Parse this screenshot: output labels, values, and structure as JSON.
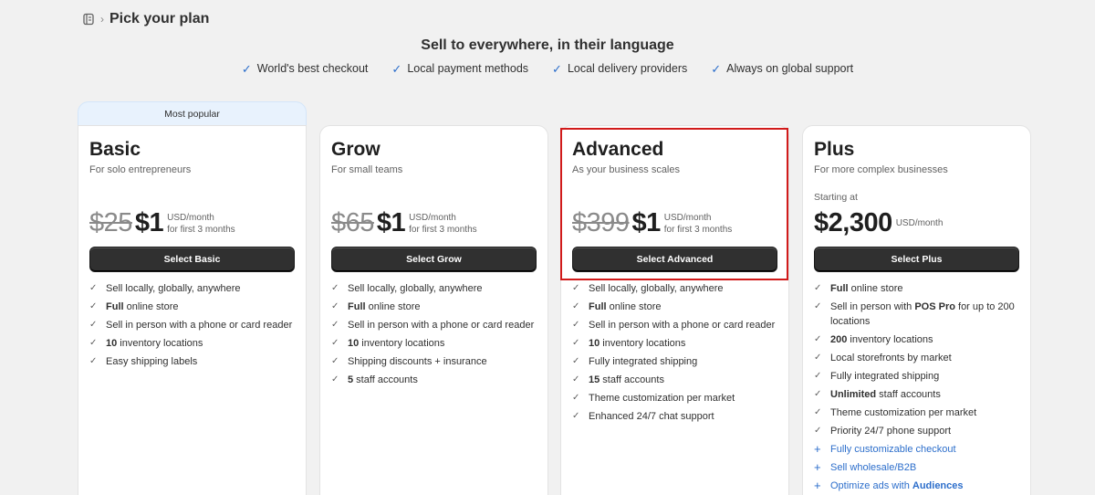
{
  "breadcrumb": {
    "icon": "store-icon",
    "separator": "›",
    "title": "Pick your plan"
  },
  "hero": {
    "title": "Sell to everywhere, in their language",
    "features": [
      "World's best checkout",
      "Local payment methods",
      "Local delivery providers",
      "Always on global support"
    ]
  },
  "badge": "Most popular",
  "plans": {
    "basic": {
      "name": "Basic",
      "sub": "For solo entrepreneurs",
      "old_price": "$25",
      "new_price": "$1",
      "note1": "USD/month",
      "note2": "for first 3 months",
      "button": "Select Basic",
      "features": [
        {
          "parts": [
            "Sell locally, globally, anywhere"
          ]
        },
        {
          "bold": "Full",
          "rest": " online store"
        },
        {
          "parts": [
            "Sell in person with a phone or card reader"
          ]
        },
        {
          "bold": "10",
          "rest": " inventory locations"
        },
        {
          "parts": [
            "Easy shipping labels"
          ]
        }
      ]
    },
    "grow": {
      "name": "Grow",
      "sub": "For small teams",
      "old_price": "$65",
      "new_price": "$1",
      "note1": "USD/month",
      "note2": "for first 3 months",
      "button": "Select Grow",
      "features": [
        {
          "parts": [
            "Sell locally, globally, anywhere"
          ]
        },
        {
          "bold": "Full",
          "rest": " online store"
        },
        {
          "parts": [
            "Sell in person with a phone or card reader"
          ]
        },
        {
          "bold": "10",
          "rest": " inventory locations"
        },
        {
          "parts": [
            "Shipping discounts + insurance"
          ]
        },
        {
          "bold": "5",
          "rest": " staff accounts"
        }
      ]
    },
    "advanced": {
      "name": "Advanced",
      "sub": "As your business scales",
      "old_price": "$399",
      "new_price": "$1",
      "note1": "USD/month",
      "note2": "for first 3 months",
      "button": "Select Advanced",
      "features": [
        {
          "parts": [
            "Sell locally, globally, anywhere"
          ]
        },
        {
          "bold": "Full",
          "rest": " online store"
        },
        {
          "parts": [
            "Sell in person with a phone or card reader"
          ]
        },
        {
          "bold": "10",
          "rest": " inventory locations"
        },
        {
          "parts": [
            "Fully integrated shipping"
          ]
        },
        {
          "bold": "15",
          "rest": " staff accounts"
        },
        {
          "parts": [
            "Theme customization per market"
          ]
        },
        {
          "parts": [
            "Enhanced 24/7 chat support"
          ]
        }
      ]
    },
    "plus": {
      "name": "Plus",
      "sub": "For more complex businesses",
      "starting": "Starting at",
      "new_price": "$2,300",
      "note1": "USD/month",
      "button": "Select Plus",
      "features": [
        {
          "bold": "Full",
          "rest": " online store"
        },
        {
          "pre": "Sell in person with ",
          "bold": "POS Pro",
          "rest": " for up to 200 locations"
        },
        {
          "bold": "200",
          "rest": " inventory locations"
        },
        {
          "parts": [
            "Local storefronts by market"
          ]
        },
        {
          "parts": [
            "Fully integrated shipping"
          ]
        },
        {
          "bold": "Unlimited",
          "rest": " staff accounts"
        },
        {
          "parts": [
            "Theme customization per market"
          ]
        },
        {
          "parts": [
            "Priority 24/7 phone support"
          ]
        },
        {
          "plus": true,
          "parts": [
            "Fully customizable checkout"
          ]
        },
        {
          "plus": true,
          "parts": [
            "Sell wholesale/B2B"
          ]
        },
        {
          "plus": true,
          "pre": "Optimize ads with ",
          "bold": "Audiences",
          "rest": ""
        }
      ]
    }
  },
  "colors": {
    "accent": "#2c6ecb",
    "button": "#303030",
    "highlight": "#d11a1a",
    "background": "#f1f1f1"
  }
}
